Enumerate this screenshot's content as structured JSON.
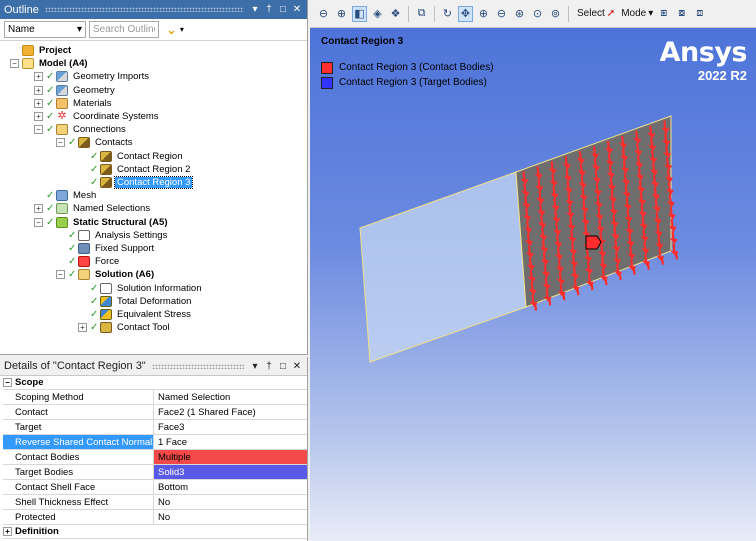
{
  "outline": {
    "title": "Outline",
    "title_buttons": [
      "▾",
      "†",
      "□",
      "✕"
    ],
    "filter_select": "Name",
    "search_placeholder": "Search Outline",
    "tree": [
      {
        "label": "Project",
        "icon": "project-icon",
        "level": 0,
        "expander": "",
        "check": "",
        "bold": true
      },
      {
        "label": "Model (A4)",
        "icon": "model-icon",
        "level": 0,
        "expander": "−",
        "check": "",
        "bold": true
      },
      {
        "label": "Geometry Imports",
        "icon": "geometry-imports-icon",
        "level": 1,
        "expander": "+",
        "check": "✓",
        "bold": false
      },
      {
        "label": "Geometry",
        "icon": "geometry-icon",
        "level": 1,
        "expander": "+",
        "check": "✓",
        "bold": false
      },
      {
        "label": "Materials",
        "icon": "materials-icon",
        "level": 1,
        "expander": "+",
        "check": "✓",
        "bold": false
      },
      {
        "label": "Coordinate Systems",
        "icon": "coordinate-systems-icon",
        "level": 1,
        "expander": "+",
        "check": "✓",
        "bold": false
      },
      {
        "label": "Connections",
        "icon": "connections-icon",
        "level": 1,
        "expander": "−",
        "check": "✓",
        "bold": false
      },
      {
        "label": "Contacts",
        "icon": "contacts-icon",
        "level": 2,
        "expander": "−",
        "check": "✓",
        "bold": false
      },
      {
        "label": "Contact Region",
        "icon": "contact-region-icon",
        "level": 3,
        "expander": "",
        "check": "✓",
        "bold": false
      },
      {
        "label": "Contact Region 2",
        "icon": "contact-region-icon",
        "level": 3,
        "expander": "",
        "check": "✓",
        "bold": false
      },
      {
        "label": "Contact Region 3",
        "icon": "contact-region-icon",
        "level": 3,
        "expander": "",
        "check": "✓",
        "bold": false,
        "selected": true
      },
      {
        "label": "Mesh",
        "icon": "mesh-icon",
        "level": 1,
        "expander": "",
        "check": "✓",
        "bold": false
      },
      {
        "label": "Named Selections",
        "icon": "named-selections-icon",
        "level": 1,
        "expander": "+",
        "check": "✓",
        "bold": false
      },
      {
        "label": "Static Structural (A5)",
        "icon": "static-structural-icon",
        "level": 1,
        "expander": "−",
        "check": "✓",
        "bold": true
      },
      {
        "label": "Analysis Settings",
        "icon": "analysis-settings-icon",
        "level": 2,
        "expander": "",
        "check": "✓",
        "bold": false
      },
      {
        "label": "Fixed Support",
        "icon": "fixed-support-icon",
        "level": 2,
        "expander": "",
        "check": "✓",
        "bold": false
      },
      {
        "label": "Force",
        "icon": "force-icon",
        "level": 2,
        "expander": "",
        "check": "✓",
        "bold": false
      },
      {
        "label": "Solution (A6)",
        "icon": "solution-icon",
        "level": 2,
        "expander": "−",
        "check": "✓",
        "bold": true
      },
      {
        "label": "Solution Information",
        "icon": "solution-information-icon",
        "level": 3,
        "expander": "",
        "check": "✓",
        "bold": false
      },
      {
        "label": "Total Deformation",
        "icon": "total-deformation-icon",
        "level": 3,
        "expander": "",
        "check": "✓",
        "bold": false
      },
      {
        "label": "Equivalent Stress",
        "icon": "equivalent-stress-icon",
        "level": 3,
        "expander": "",
        "check": "✓",
        "bold": false
      },
      {
        "label": "Contact Tool",
        "icon": "contact-tool-icon",
        "level": 3,
        "expander": "+",
        "check": "✓",
        "bold": false
      }
    ]
  },
  "details": {
    "title": "Details of \"Contact Region 3\"",
    "title_buttons": [
      "▾",
      "†",
      "□",
      "✕"
    ],
    "group_scope": "Scope",
    "group_definition": "Definition",
    "rows": [
      {
        "key": "Scoping Method",
        "value": "Named Selection"
      },
      {
        "key": "Contact",
        "value": "Face2 (1 Shared Face)"
      },
      {
        "key": "Target",
        "value": "Face3"
      },
      {
        "key": "Reverse Shared Contact Normal",
        "value": "1 Face"
      },
      {
        "key": "Contact Bodies",
        "value": "Multiple"
      },
      {
        "key": "Target Bodies",
        "value": "Solid3"
      },
      {
        "key": "Contact Shell Face",
        "value": "Bottom"
      },
      {
        "key": "Shell Thickness Effect",
        "value": "No"
      },
      {
        "key": "Protected",
        "value": "No"
      }
    ]
  },
  "viewport": {
    "toolbar": {
      "select_label": "Select",
      "mode_label": "Mode",
      "icons": [
        "zoom-to-fit-icon",
        "zoom-icon",
        "box-icon",
        "shaded-icon",
        "wireframe-icon",
        "graphics-icon",
        "rotate-icon",
        "pan-icon",
        "zoom-in-icon",
        "zoom-out-icon",
        "box-zoom-icon",
        "zoom-fit-icon",
        "magnify-icon"
      ]
    },
    "legend": {
      "title": "Contact Region 3",
      "items": [
        {
          "label": "Contact Region 3 (Contact Bodies)",
          "color": "#ff2d2d"
        },
        {
          "label": "Contact Region 3 (Target Bodies)",
          "color": "#3333ff"
        }
      ]
    },
    "brand": {
      "name": "Ansys",
      "version": "2022 R2"
    },
    "colors": {
      "contact": "#ff2d2d",
      "target_face": "#6e6e6e",
      "plate": "#c5d7f3",
      "edge": "#f2e08a"
    }
  }
}
